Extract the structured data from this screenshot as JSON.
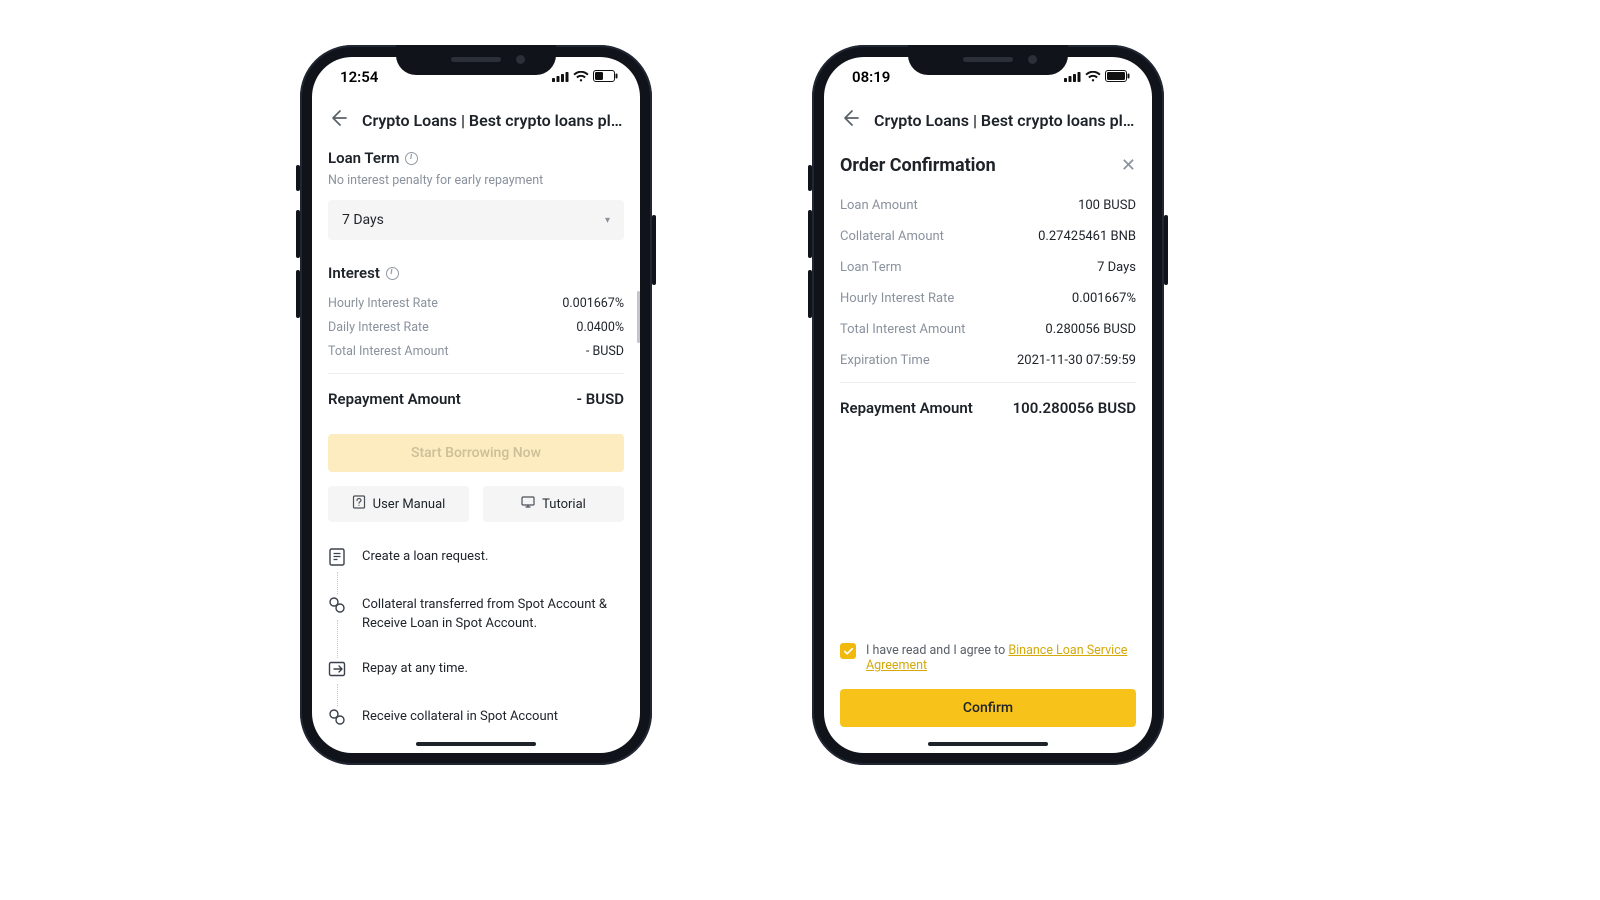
{
  "left": {
    "status_time": "12:54",
    "header_title": "Crypto Loans | Best crypto loans plat...",
    "loan_term": {
      "title": "Loan Term",
      "subtitle": "No interest penalty for early repayment",
      "selected": "7 Days"
    },
    "interest": {
      "title": "Interest",
      "hourly_label": "Hourly Interest Rate",
      "hourly_value": "0.001667%",
      "daily_label": "Daily Interest Rate",
      "daily_value": "0.0400%",
      "total_label": "Total Interest Amount",
      "total_value": "- BUSD"
    },
    "repayment": {
      "label": "Repayment Amount",
      "value": "- BUSD"
    },
    "primary_btn": "Start Borrowing Now",
    "secondary": {
      "manual": "User Manual",
      "tutorial": "Tutorial"
    },
    "steps": [
      "Create a loan request.",
      "Collateral transferred from Spot Account & Receive Loan in Spot Account.",
      "Repay at any time.",
      "Receive collateral in Spot Account"
    ]
  },
  "right": {
    "status_time": "08:19",
    "header_title": "Crypto Loans | Best crypto loans plat...",
    "modal_title": "Order Confirmation",
    "rows": {
      "loan_amount_label": "Loan Amount",
      "loan_amount_value": "100 BUSD",
      "collateral_label": "Collateral Amount",
      "collateral_value": "0.27425461 BNB",
      "term_label": "Loan Term",
      "term_value": "7 Days",
      "hourly_label": "Hourly Interest Rate",
      "hourly_value": "0.001667%",
      "total_interest_label": "Total Interest Amount",
      "total_interest_value": "0.280056 BUSD",
      "expiry_label": "Expiration Time",
      "expiry_value": "2021-11-30 07:59:59"
    },
    "repayment": {
      "label": "Repayment Amount",
      "value": "100.280056 BUSD"
    },
    "agree_text_pre": "I have read and I agree to ",
    "agree_link": "Binance Loan Service Agreement",
    "confirm_btn": "Confirm"
  }
}
